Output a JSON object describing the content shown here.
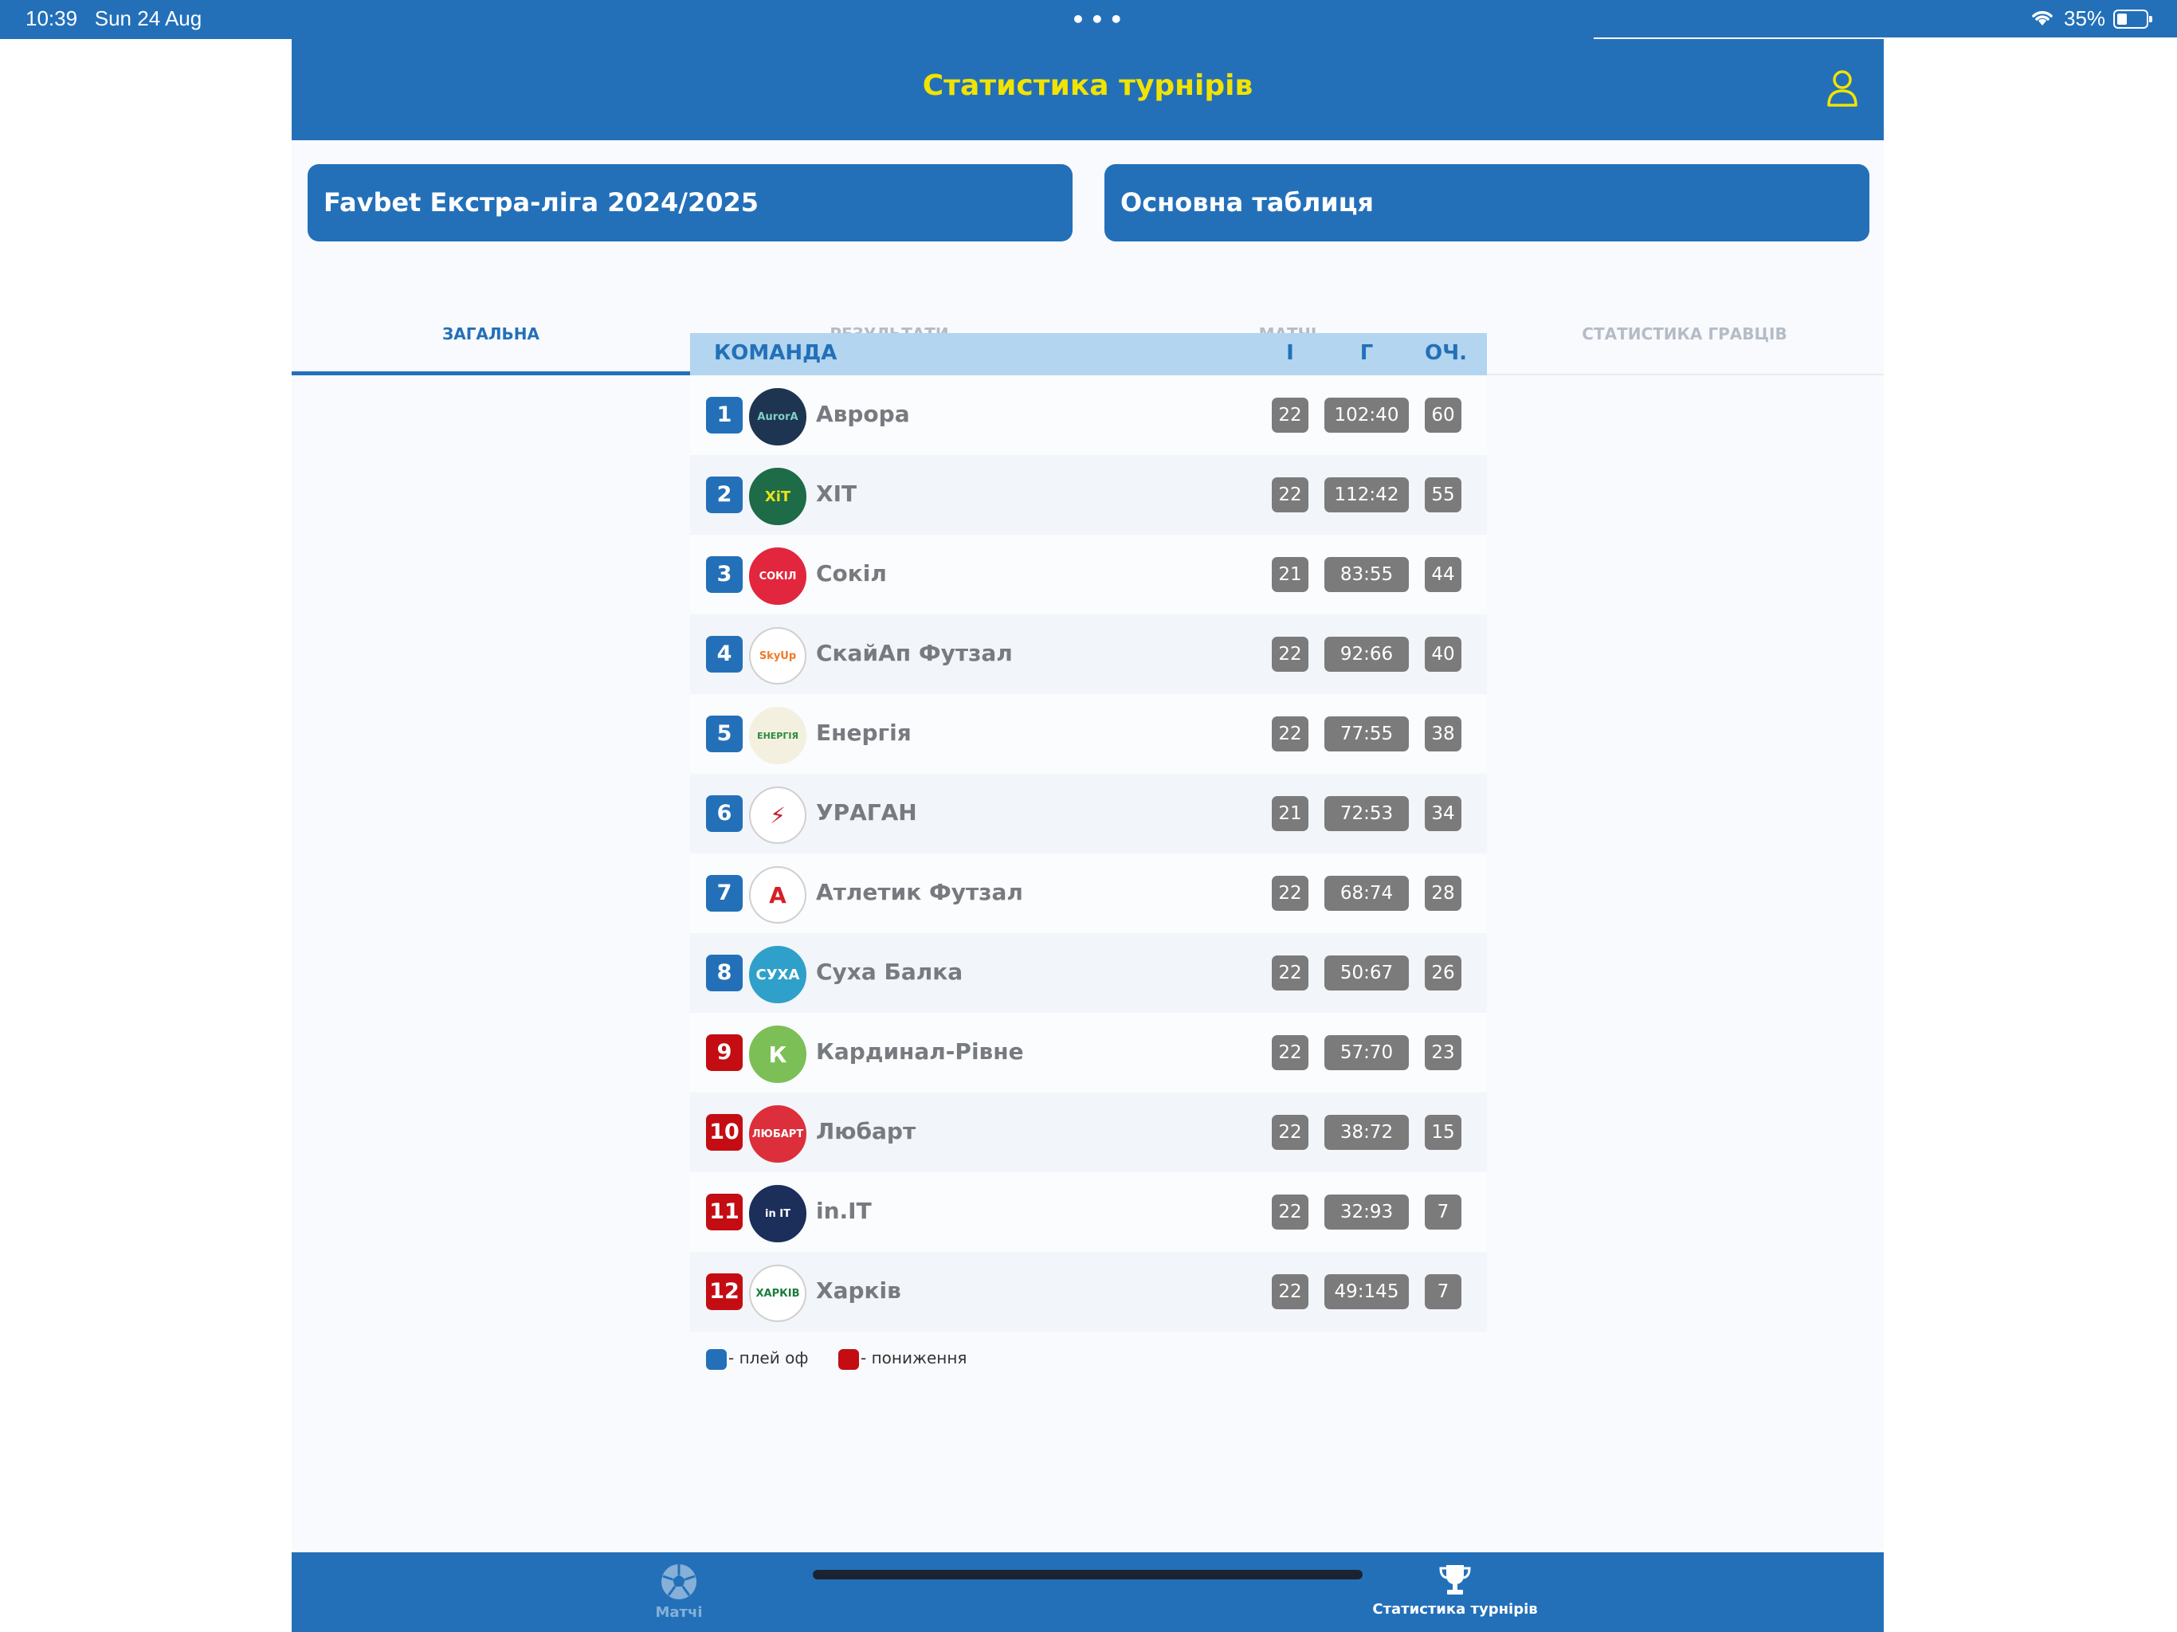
{
  "status_bar": {
    "time": "10:39",
    "date": "Sun 24 Aug",
    "dots": "•••",
    "battery": "35%"
  },
  "header": {
    "title": "Статистика турнірів"
  },
  "selectors": {
    "tournament": "Favbet Екстра-ліга 2024/2025",
    "table": "Основна таблиця"
  },
  "tabs": [
    {
      "label": "ЗАГАЛЬНА",
      "active": true
    },
    {
      "label": "РЕЗУЛЬТАТИ",
      "active": false
    },
    {
      "label": "МАТЧІ",
      "active": false
    },
    {
      "label": "СТАТИСТИКА ГРАВЦІВ",
      "active": false
    }
  ],
  "table": {
    "headers": {
      "team": "КОМАНДА",
      "games": "І",
      "goals": "Г",
      "points": "ОЧ."
    },
    "rows": [
      {
        "rank": "1",
        "name": "Аврора",
        "games": "22",
        "goals": "102:40",
        "points": "60",
        "zone": "blue",
        "logo_color": "#1e3552",
        "logo_text": "AurorA",
        "logo_fg": "#7fd0c6"
      },
      {
        "rank": "2",
        "name": "ХІТ",
        "games": "22",
        "goals": "112:42",
        "points": "55",
        "zone": "blue",
        "logo_color": "#1d6b47",
        "logo_text": "XiT",
        "logo_fg": "#e8e21a"
      },
      {
        "rank": "3",
        "name": "Сокіл",
        "games": "21",
        "goals": "83:55",
        "points": "44",
        "zone": "blue",
        "logo_color": "#e2263d",
        "logo_text": "СОКІЛ",
        "logo_fg": "#ffffff"
      },
      {
        "rank": "4",
        "name": "СкайАп Футзал",
        "games": "22",
        "goals": "92:66",
        "points": "40",
        "zone": "blue",
        "logo_color": "#ffffff",
        "logo_text": "SkyUp",
        "logo_fg": "#f07a28"
      },
      {
        "rank": "5",
        "name": "Енергія",
        "games": "22",
        "goals": "77:55",
        "points": "38",
        "zone": "blue",
        "logo_color": "#f3f0df",
        "logo_text": "ЕНЕРГІЯ",
        "logo_fg": "#2a8a3c"
      },
      {
        "rank": "6",
        "name": "УРАГАН",
        "games": "21",
        "goals": "72:53",
        "points": "34",
        "zone": "blue",
        "logo_color": "#ffffff",
        "logo_text": "⚡",
        "logo_fg": "#c4202b"
      },
      {
        "rank": "7",
        "name": "Атлетик Футзал",
        "games": "22",
        "goals": "68:74",
        "points": "28",
        "zone": "blue",
        "logo_color": "#ffffff",
        "logo_text": "A",
        "logo_fg": "#d51f26"
      },
      {
        "rank": "8",
        "name": "Суха Балка",
        "games": "22",
        "goals": "50:67",
        "points": "26",
        "zone": "blue",
        "logo_color": "#2fa0c9",
        "logo_text": "СУХА",
        "logo_fg": "#ffffff"
      },
      {
        "rank": "9",
        "name": "Кардинал-Рівне",
        "games": "22",
        "goals": "57:70",
        "points": "23",
        "zone": "red",
        "logo_color": "#7cbf57",
        "logo_text": "К",
        "logo_fg": "#ffffff"
      },
      {
        "rank": "10",
        "name": "Любарт",
        "games": "22",
        "goals": "38:72",
        "points": "15",
        "zone": "red",
        "logo_color": "#dd2f3b",
        "logo_text": "ЛЮБАРТ",
        "logo_fg": "#ffffff"
      },
      {
        "rank": "11",
        "name": "in.IT",
        "games": "22",
        "goals": "32:93",
        "points": "7",
        "zone": "red",
        "logo_color": "#1b2f5a",
        "logo_text": "in IT",
        "logo_fg": "#ffffff"
      },
      {
        "rank": "12",
        "name": "Харків",
        "games": "22",
        "goals": "49:145",
        "points": "7",
        "zone": "red",
        "logo_color": "#ffffff",
        "logo_text": "ХАРКІВ",
        "logo_fg": "#1a7d3e"
      }
    ]
  },
  "legend": {
    "playoff": "- плей оф",
    "relegation": "- пониження",
    "playoff_color": "#2370b9",
    "relegation_color": "#c40d12"
  },
  "tabbar": {
    "matches": "Матчі",
    "stats": "Статистика турнірів",
    "matches_icon": "soccer-ball-icon",
    "stats_icon": "trophy-icon"
  }
}
